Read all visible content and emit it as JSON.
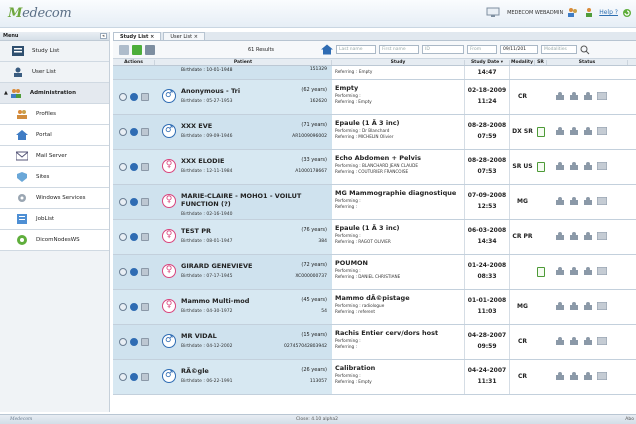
{
  "app": {
    "logo_prefix": "M",
    "logo_text": "edecom",
    "user": "MEDECOM WEBADMIN",
    "help": "Help ?"
  },
  "sidebar": {
    "header": "Menu",
    "collapse": "«",
    "items": [
      {
        "label": "Study List",
        "icon": "study-list-icon"
      },
      {
        "label": "User List",
        "icon": "user-list-icon"
      },
      {
        "label": "Administration",
        "icon": "administration-icon"
      },
      {
        "label": "Profiles",
        "icon": "profiles-icon"
      },
      {
        "label": "Portal",
        "icon": "portal-icon"
      },
      {
        "label": "Mail Server",
        "icon": "mail-server-icon"
      },
      {
        "label": "Sites",
        "icon": "sites-icon"
      },
      {
        "label": "Windows Services",
        "icon": "windows-services-icon"
      },
      {
        "label": "JobList",
        "icon": "joblist-icon"
      },
      {
        "label": "DicomNodesWS",
        "icon": "dicom-nodes-icon"
      }
    ]
  },
  "tabs": [
    {
      "label": "Study List",
      "close": "×"
    },
    {
      "label": "User List",
      "close": "×"
    }
  ],
  "toolbar": {
    "results": "61 Results",
    "last_name": "Last name",
    "first_name": "First name",
    "id": "ID",
    "from": "From",
    "date": "09/11/201",
    "modalities": "Modalities"
  },
  "columns": {
    "actions": "Actions",
    "patient": "Patient",
    "study": "Study",
    "study_date": "Study Date ▾",
    "modality": "Modality",
    "sr": "SR",
    "status": "Status"
  },
  "first_row_partial": {
    "birth": "Birthdate : 10-01-1948",
    "id": "151329",
    "study_line": "Referring :",
    "study_val": "Empty",
    "time": "14:47"
  },
  "rows": [
    {
      "gender": "male",
      "name": "Anonymous - Tri",
      "age": "(62 years)",
      "birth": "Birthdate : 05-27-1953",
      "id": "162620",
      "study": "Empty",
      "l1": "Performing :",
      "l2": "Referring :",
      "l2v": "Empty",
      "date": "02-18-2009",
      "time": "11:24",
      "modality": "CR",
      "sr": false
    },
    {
      "gender": "male",
      "name": "XXX EVE",
      "age": "(71 years)",
      "birth": "Birthdate : 09-09-1946",
      "id": "AR1009096002",
      "study": "Epaule (1 Ã  3 inc)",
      "l1": "Performing : Dr Blanchard",
      "l2": "Referring :",
      "l2v": "MICHELIN Olivier",
      "date": "08-28-2008",
      "time": "07:59",
      "modality": "DX SR",
      "sr": true
    },
    {
      "gender": "female",
      "name": "XXX ELODIE",
      "age": "(33 years)",
      "birth": "Birthdate : 12-11-1984",
      "id": "A1000178667",
      "study": "Echo Abdomen + Pelvis",
      "l1": "Performing : BLANCHARD JEAN CLAUDE",
      "l2": "Referring :",
      "l2v": "COUTURIER FRANCOISE",
      "date": "08-28-2008",
      "time": "07:53",
      "modality": "SR US",
      "sr": true
    },
    {
      "gender": "female",
      "name": "MARIE-CLAIRE - MOHO1 - VOILUT FUNCTION (?)",
      "age": "",
      "birth": "Birthdate : 02-16-1940",
      "id": "",
      "study": "MG Mammographie diagnostique",
      "l1": "Performing :",
      "l2": "Referring :",
      "l2v": "",
      "date": "07-09-2008",
      "time": "12:53",
      "modality": "MG",
      "sr": false
    },
    {
      "gender": "female",
      "name": "TEST PR",
      "age": "(76 years)",
      "birth": "Birthdate : 08-01-1947",
      "id": "384",
      "study": "Epaule (1 Ã  3 inc)",
      "l1": "Performing :",
      "l2": "Referring :",
      "l2v": "RAGOT OLIVIER",
      "date": "06-03-2008",
      "time": "14:34",
      "modality": "CR PR",
      "sr": false
    },
    {
      "gender": "female",
      "name": "GIRARD GENEVIEVE",
      "age": "(72 years)",
      "birth": "Birthdate : 07-17-1945",
      "id": "XC000000737",
      "study": "POUMON",
      "l1": "Performing :",
      "l2": "Referring :",
      "l2v": "DANIEL CHRISTIANE",
      "date": "01-24-2008",
      "time": "08:33",
      "modality": "",
      "sr": true
    },
    {
      "gender": "female",
      "name": "Mammo Multi-mod",
      "age": "(45 years)",
      "birth": "Birthdate : 04-30-1972",
      "id": "54",
      "study": "Mammo dÃ©pistage",
      "l1": "Performing : radiologue",
      "l2": "Referring :",
      "l2v": "referent",
      "date": "01-01-2008",
      "time": "11:03",
      "modality": "MG",
      "sr": false
    },
    {
      "gender": "male",
      "name": "MR VIDAL",
      "age": "(15 years)",
      "birth": "Birthdate : 04-12-2002",
      "id": "027457042803942",
      "study": "Rachis Entier cerv/dors host",
      "l1": "Performing :",
      "l2": "Referring :",
      "l2v": "",
      "date": "04-28-2007",
      "time": "09:59",
      "modality": "CR",
      "sr": false
    },
    {
      "gender": "male",
      "name": "RÃ©gle",
      "age": "(26 years)",
      "birth": "Birthdate : 06-22-1991",
      "id": "113057",
      "study": "Calibration",
      "l1": "Performing :",
      "l2": "Referring :",
      "l2v": "Empty",
      "date": "04-24-2007",
      "time": "11:31",
      "modality": "CR",
      "sr": false
    }
  ],
  "statusbar": {
    "logo": "Medecom",
    "center": "Close: 4.10 alpha2",
    "right": "Abo"
  }
}
